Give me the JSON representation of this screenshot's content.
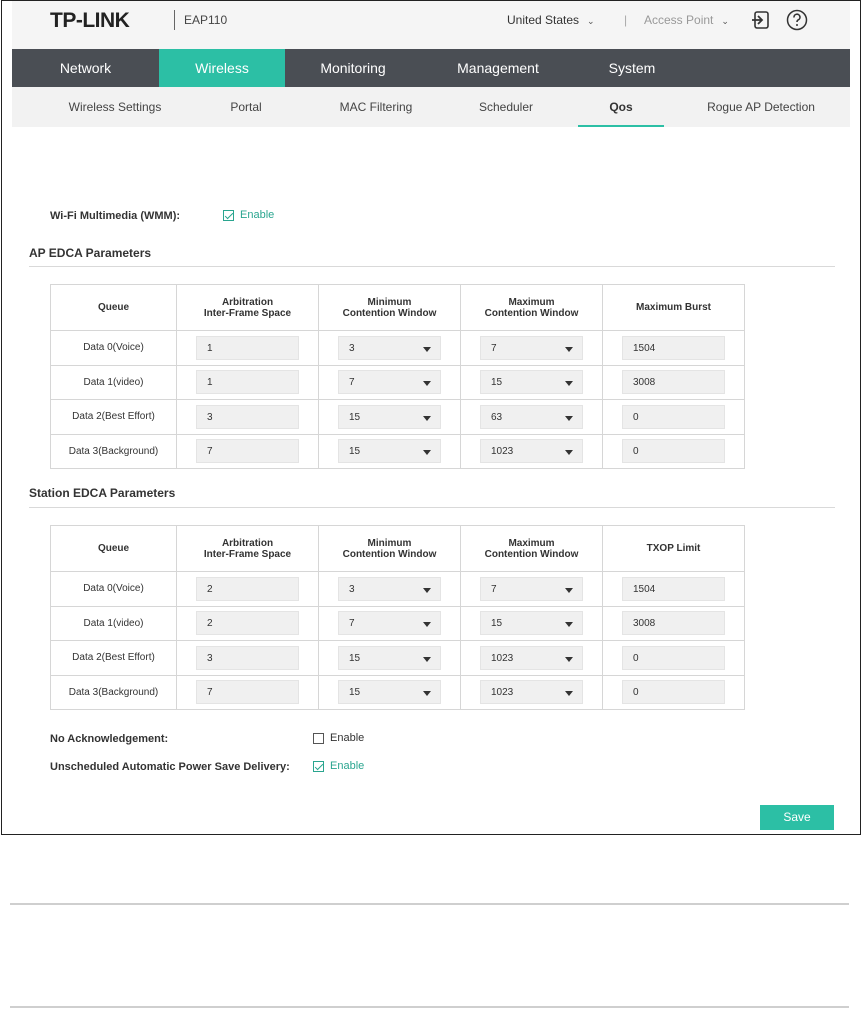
{
  "header": {
    "brand": "TP-LINK",
    "model": "EAP110",
    "region": "United States",
    "mode": "Access Point",
    "caret": "⌄"
  },
  "main_nav": [
    "Network",
    "Wireless",
    "Monitoring",
    "Management",
    "System"
  ],
  "main_nav_active": "Wireless",
  "sub_nav": [
    "Wireless Settings",
    "Portal",
    "MAC Filtering",
    "Scheduler",
    "Qos",
    "Rogue AP Detection"
  ],
  "sub_nav_active": "Qos",
  "wmm": {
    "label": "Wi-Fi Multimedia (WMM):",
    "option": "Enable",
    "checked": true
  },
  "ap_edca": {
    "title": "AP EDCA Parameters",
    "headers": [
      "Queue",
      "Arbitration\nInter-Frame Space",
      "Minimum\nContention Window",
      "Maximum\nContention Window",
      "Maximum Burst"
    ],
    "rows": [
      {
        "queue": "Data 0(Voice)",
        "aifs": "1",
        "cwmin": "3",
        "cwmax": "7",
        "last": "1504"
      },
      {
        "queue": "Data 1(video)",
        "aifs": "1",
        "cwmin": "7",
        "cwmax": "15",
        "last": "3008"
      },
      {
        "queue": "Data 2(Best Effort)",
        "aifs": "3",
        "cwmin": "15",
        "cwmax": "63",
        "last": "0"
      },
      {
        "queue": "Data 3(Background)",
        "aifs": "7",
        "cwmin": "15",
        "cwmax": "1023",
        "last": "0"
      }
    ]
  },
  "station_edca": {
    "title": "Station EDCA Parameters",
    "headers": [
      "Queue",
      "Arbitration\nInter-Frame Space",
      "Minimum\nContention Window",
      "Maximum\nContention Window",
      "TXOP Limit"
    ],
    "rows": [
      {
        "queue": "Data 0(Voice)",
        "aifs": "2",
        "cwmin": "3",
        "cwmax": "7",
        "last": "1504"
      },
      {
        "queue": "Data 1(video)",
        "aifs": "2",
        "cwmin": "7",
        "cwmax": "15",
        "last": "3008"
      },
      {
        "queue": "Data 2(Best Effort)",
        "aifs": "3",
        "cwmin": "15",
        "cwmax": "1023",
        "last": "0"
      },
      {
        "queue": "Data 3(Background)",
        "aifs": "7",
        "cwmin": "15",
        "cwmax": "1023",
        "last": "0"
      }
    ]
  },
  "no_ack": {
    "label": "No Acknowledgement:",
    "option": "Enable",
    "checked": false
  },
  "uapsd": {
    "label": "Unscheduled Automatic Power Save Delivery:",
    "option": "Enable",
    "checked": true
  },
  "save_label": "Save",
  "colors": {
    "accent": "#2cbfa5",
    "nav_bg": "#4a4e54"
  }
}
